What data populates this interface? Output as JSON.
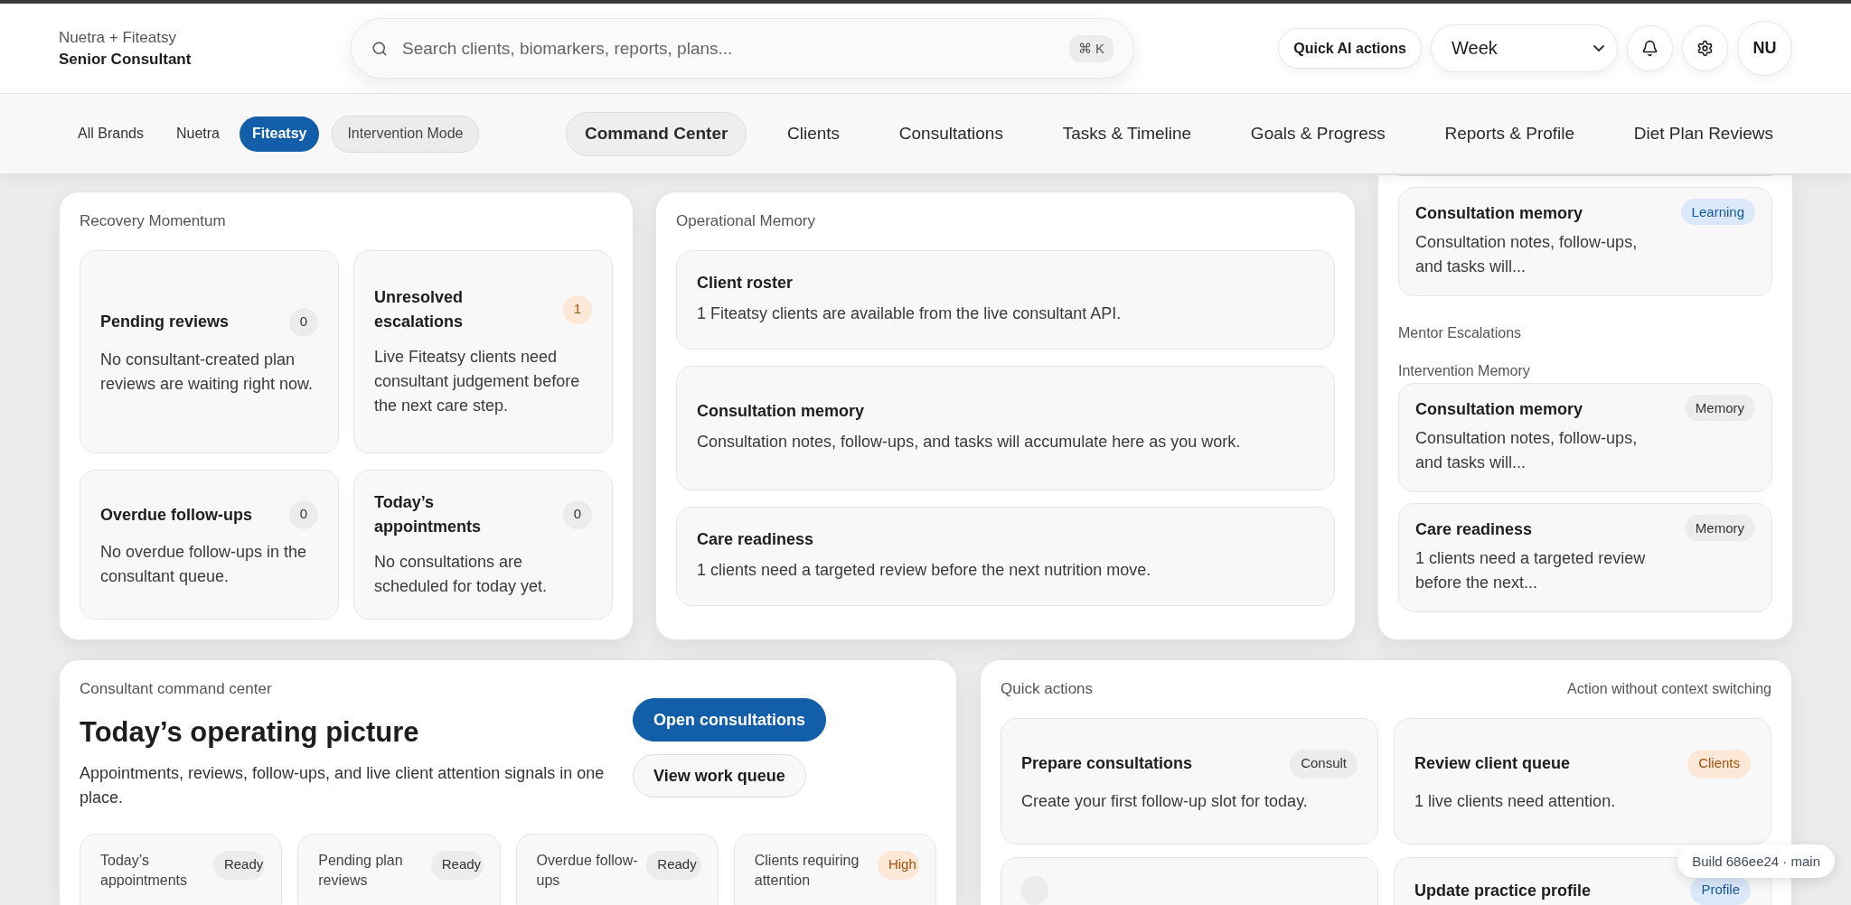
{
  "header": {
    "brand": {
      "name": "Nuetra + Fiteatsy",
      "role": "Senior Consultant"
    },
    "search": {
      "placeholder": "Search clients, biomarkers, reports, plans...",
      "shortcut": "⌘ K"
    },
    "quick_ai": "Quick AI actions",
    "period": "Week",
    "avatar": "NU"
  },
  "brand_filters": [
    {
      "label": "All Brands",
      "selected": false
    },
    {
      "label": "Nuetra",
      "selected": false
    },
    {
      "label": "Fiteatsy",
      "selected": true
    }
  ],
  "intervention_mode": {
    "label": "Intervention Mode",
    "on": false
  },
  "tabs": [
    {
      "label": "Command Center",
      "selected": true
    },
    {
      "label": "Clients",
      "selected": false
    },
    {
      "label": "Consultations",
      "selected": false
    },
    {
      "label": "Tasks & Timeline",
      "selected": false
    },
    {
      "label": "Goals & Progress",
      "selected": false
    },
    {
      "label": "Reports & Profile",
      "selected": false
    },
    {
      "label": "Diet Plan Reviews",
      "selected": false
    }
  ],
  "recovery": {
    "title": "Recovery Momentum",
    "metrics": [
      {
        "title": "Pending reviews",
        "count": "0",
        "kind": "neutral",
        "text": "No consultant-created plan reviews are waiting right now."
      },
      {
        "title": "Unresolved escalations",
        "count": "1",
        "kind": "alert",
        "text": "Live Fiteatsy clients need consultant judgement before the next care step."
      },
      {
        "title": "Overdue follow-ups",
        "count": "0",
        "kind": "neutral",
        "text": "No overdue follow-ups in the consultant queue."
      },
      {
        "title": "Today’s appointments",
        "count": "0",
        "kind": "neutral",
        "text": "No consultations are scheduled for today yet."
      }
    ]
  },
  "operational_memory": {
    "title": "Operational Memory",
    "items": [
      {
        "title": "Client roster",
        "text": "1 Fiteatsy clients are available from the live consultant API."
      },
      {
        "title": "Consultation memory",
        "text": "Consultation notes, follow-ups, and tasks will accumulate here as you work."
      },
      {
        "title": "Care readiness",
        "text": "1 clients need a targeted review before the next nutrition move."
      }
    ]
  },
  "side_panel": {
    "top_cards": [
      {
        "title": "Consultation memory",
        "text": "Consultation notes, follow-ups, and tasks will...",
        "tag": "Learning",
        "kind": "info"
      }
    ],
    "mentor_label": "Mentor Escalations",
    "intervention_label": "Intervention Memory",
    "intervention_cards": [
      {
        "title": "Consultation memory",
        "text": "Consultation notes, follow-ups, and tasks will...",
        "tag": "Memory",
        "kind": "neutral"
      },
      {
        "title": "Care readiness",
        "text": "1 clients need a targeted review before the next...",
        "tag": "Memory",
        "kind": "neutral"
      }
    ]
  },
  "command_center": {
    "eyebrow": "Consultant command center",
    "heading": "Today’s operating picture",
    "text": "Appointments, reviews, follow-ups, and live client attention signals in one place.",
    "buttons": [
      {
        "label": "Open consultations",
        "kind": "primary"
      },
      {
        "label": "View work queue",
        "kind": "secondary"
      }
    ],
    "metrics": [
      {
        "label": "Today’s appointments",
        "status": "Ready",
        "kind": "neutral"
      },
      {
        "label": "Pending plan reviews",
        "status": "Ready",
        "kind": "neutral"
      },
      {
        "label": "Overdue follow-ups",
        "status": "Ready",
        "kind": "neutral"
      },
      {
        "label": "Clients requiring attention",
        "status": "High",
        "kind": "alert"
      }
    ]
  },
  "quick_actions": {
    "title": "Quick actions",
    "hint": "Action without context switching",
    "actions": [
      {
        "title": "Prepare consultations",
        "tag": "Consult",
        "kind": "neutral",
        "text": "Create your first follow-up slot for today."
      },
      {
        "title": "Review client queue",
        "tag": "Clients",
        "kind": "alert",
        "text": "1 live clients need attention."
      },
      {
        "kind": "neutral"
      },
      {
        "title": "Update practice profile",
        "tag": "Profile",
        "kind": "info"
      }
    ]
  },
  "build": "Build 686ee24 · main"
}
